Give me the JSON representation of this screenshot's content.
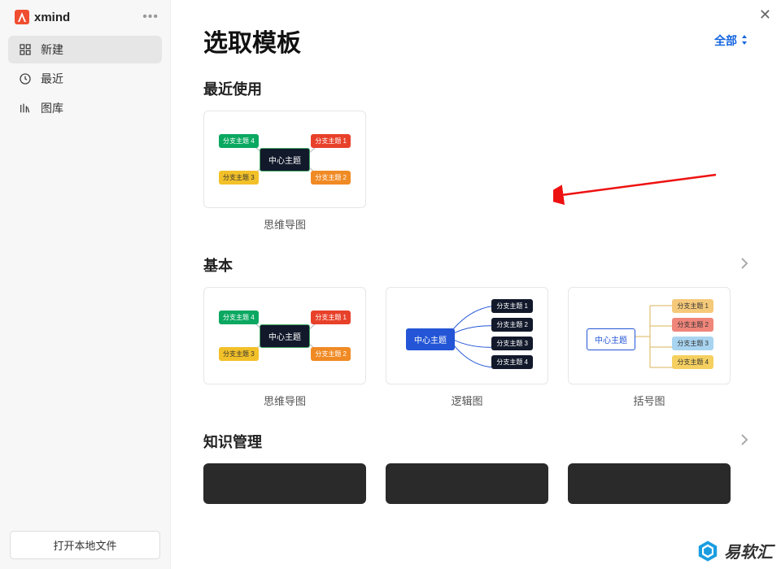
{
  "brand": {
    "name": "xmind"
  },
  "sidebar": {
    "items": [
      {
        "label": "新建"
      },
      {
        "label": "最近"
      },
      {
        "label": "图库"
      }
    ],
    "open_local": "打开本地文件"
  },
  "header": {
    "title": "选取模板",
    "filter_label": "全部"
  },
  "sections": {
    "recent": {
      "title": "最近使用",
      "cards": [
        {
          "label": "思维导图",
          "center": "中心主题",
          "tl": "分支主题 4",
          "tr": "分支主题 1",
          "bl": "分支主题 3",
          "br": "分支主题 2"
        }
      ]
    },
    "basic": {
      "title": "基本",
      "cards": [
        {
          "label": "思维导图",
          "center": "中心主题",
          "tl": "分支主题 4",
          "tr": "分支主题 1",
          "bl": "分支主题 3",
          "br": "分支主题 2"
        },
        {
          "label": "逻辑图",
          "center": "中心主题",
          "n1": "分支主题 1",
          "n2": "分支主题 2",
          "n3": "分支主题 3",
          "n4": "分支主题 4"
        },
        {
          "label": "括号图",
          "center": "中心主题",
          "n1": "分支主题 1",
          "n2": "分支主题 2",
          "n3": "分支主题 3",
          "n4": "分支主题 4"
        }
      ]
    },
    "knowledge": {
      "title": "知识管理"
    }
  },
  "watermark": {
    "text": "易软汇"
  }
}
